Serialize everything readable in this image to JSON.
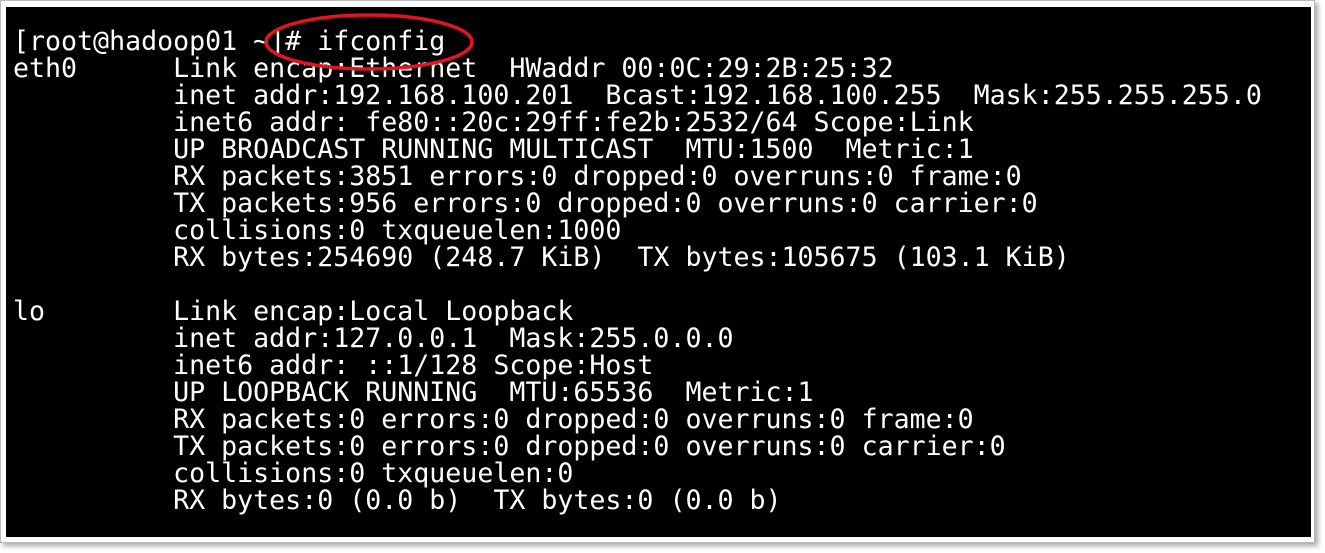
{
  "terminal": {
    "prompt": "[root@hadoop01 ~]# ",
    "command": "ifconfig",
    "highlight_color": "#e0161d",
    "output": {
      "eth0": [
        "eth0      Link encap:Ethernet  HWaddr 00:0C:29:2B:25:32",
        "          inet addr:192.168.100.201  Bcast:192.168.100.255  Mask:255.255.255.0",
        "          inet6 addr: fe80::20c:29ff:fe2b:2532/64 Scope:Link",
        "          UP BROADCAST RUNNING MULTICAST  MTU:1500  Metric:1",
        "          RX packets:3851 errors:0 dropped:0 overruns:0 frame:0",
        "          TX packets:956 errors:0 dropped:0 overruns:0 carrier:0",
        "          collisions:0 txqueuelen:1000",
        "          RX bytes:254690 (248.7 KiB)  TX bytes:105675 (103.1 KiB)"
      ],
      "lo": [
        "lo        Link encap:Local Loopback",
        "          inet addr:127.0.0.1  Mask:255.0.0.0",
        "          inet6 addr: ::1/128 Scope:Host",
        "          UP LOOPBACK RUNNING  MTU:65536  Metric:1",
        "          RX packets:0 errors:0 dropped:0 overruns:0 frame:0",
        "          TX packets:0 errors:0 dropped:0 overruns:0 carrier:0",
        "          collisions:0 txqueuelen:0",
        "          RX bytes:0 (0.0 b)  TX bytes:0 (0.0 b)"
      ]
    }
  }
}
